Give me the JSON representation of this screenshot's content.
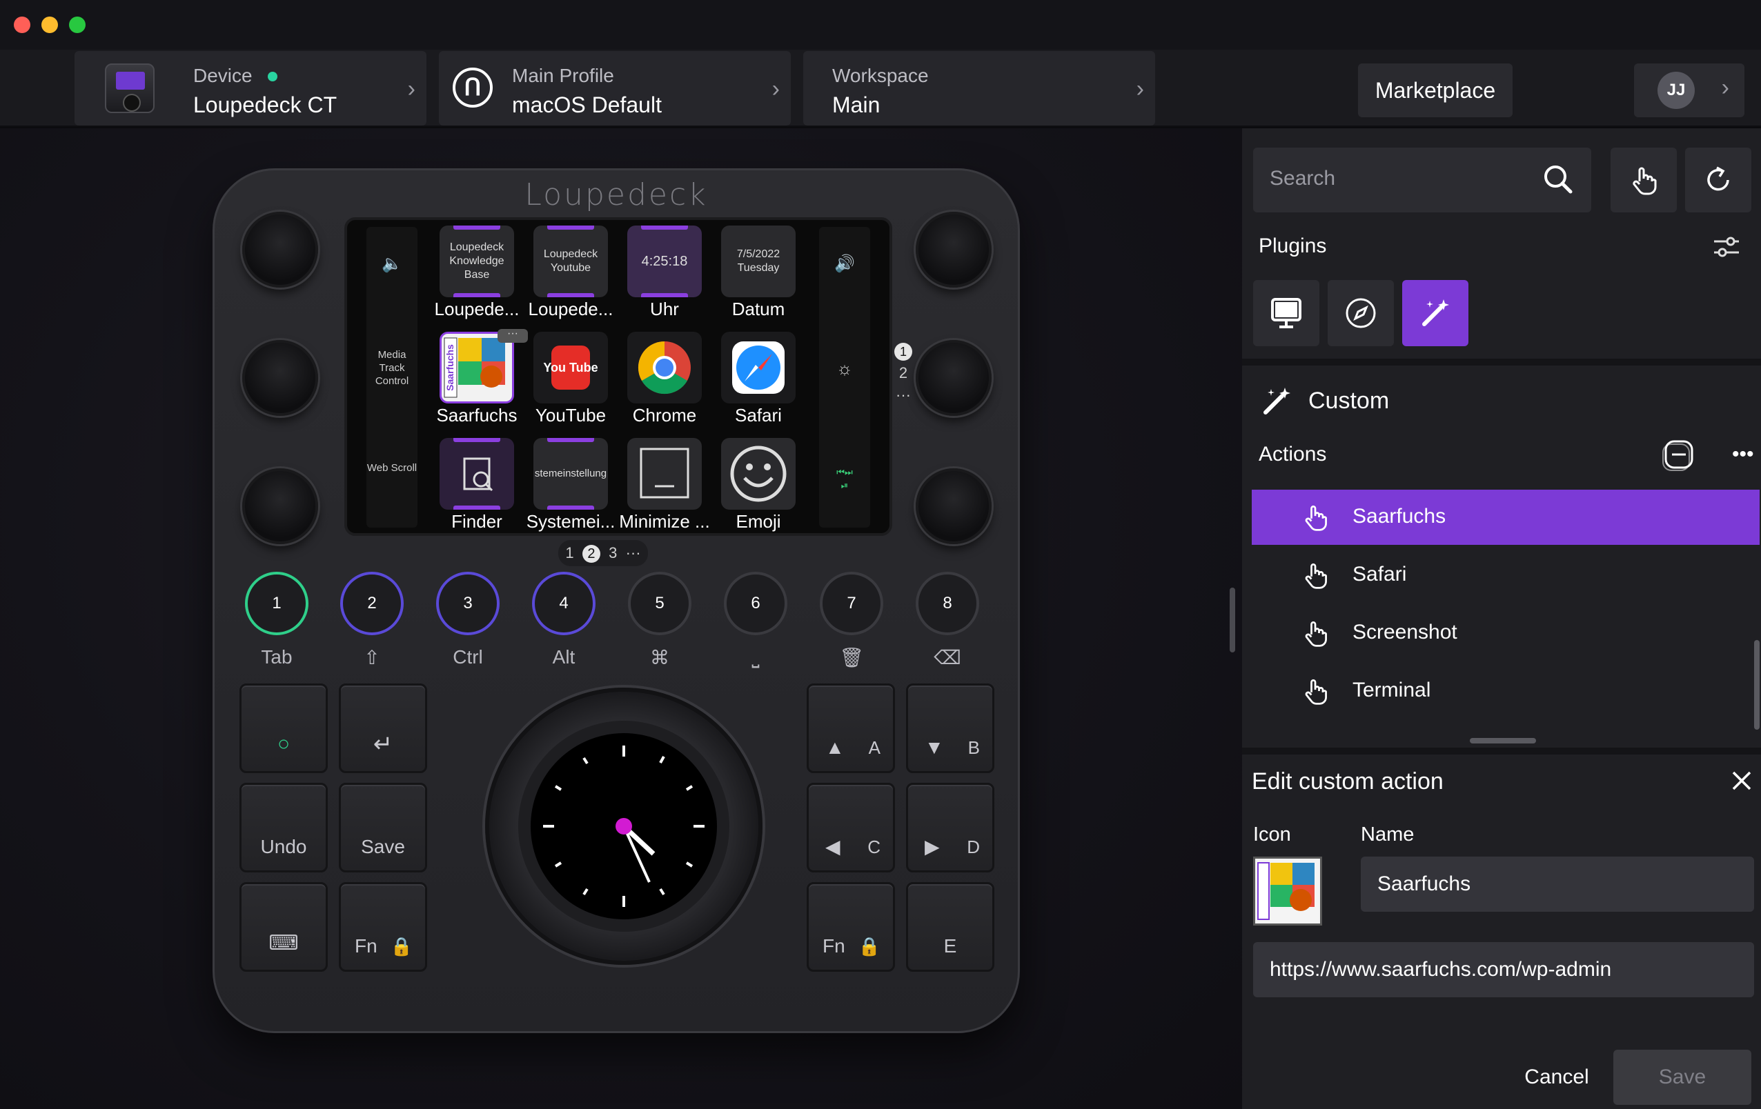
{
  "topbar": {
    "device": {
      "label": "Device",
      "value": "Loupedeck CT",
      "status_color": "#29d3a0"
    },
    "profile": {
      "label": "Main Profile",
      "value": "macOS Default"
    },
    "workspace": {
      "label": "Workspace",
      "value": "Main"
    },
    "marketplace": "Marketplace",
    "user_initials": "JJ"
  },
  "device": {
    "brand": "Loupedeck",
    "left_column": [
      "Media Track Control",
      "Web Scroll"
    ],
    "tiles": [
      {
        "text": "Loupedeck Knowledge Base",
        "label": "Loupede..."
      },
      {
        "text": "Loupedeck Youtube",
        "label": "Loupede..."
      },
      {
        "text": "4:25:18",
        "label": "Uhr"
      },
      {
        "text": "7/5/2022 Tuesday",
        "label": "Datum"
      },
      {
        "text": "Saarfuchs",
        "label": "Saarfuchs"
      },
      {
        "text": "You Tube",
        "label": "YouTube"
      },
      {
        "text": "",
        "label": "Chrome"
      },
      {
        "text": "",
        "label": "Safari"
      },
      {
        "text": "",
        "label": "Finder"
      },
      {
        "text": "stemeinstellung",
        "label": "Systemei..."
      },
      {
        "text": "",
        "label": "Minimize ..."
      },
      {
        "text": "",
        "label": "Emoji"
      }
    ],
    "tile_more": "···",
    "page_indicator": {
      "pages": [
        "1",
        "2",
        "3"
      ],
      "current": "2",
      "more": "···"
    },
    "vertical_page_indicator": {
      "pages": [
        "1",
        "2"
      ],
      "current": "1",
      "more": "···"
    },
    "round_buttons": [
      {
        "num": "1",
        "label": "Tab"
      },
      {
        "num": "2",
        "label": "⇧"
      },
      {
        "num": "3",
        "label": "Ctrl"
      },
      {
        "num": "4",
        "label": "Alt"
      },
      {
        "num": "5",
        "label": "⌘"
      },
      {
        "num": "6",
        "label": "⎵"
      },
      {
        "num": "7",
        "label": "🗑"
      },
      {
        "num": "8",
        "label": "⌫"
      }
    ],
    "keys": {
      "undo": "Undo",
      "save": "Save",
      "fn": "Fn",
      "a": "A",
      "b": "B",
      "c": "C",
      "d": "D",
      "e": "E"
    },
    "accent_green": "#2fcf8a",
    "accent_purple": "#7c3ad6"
  },
  "panel": {
    "search_placeholder": "Search",
    "plugins_label": "Plugins",
    "custom_title": "Custom",
    "actions_label": "Actions",
    "actions": [
      "Saarfuchs",
      "Safari",
      "Screenshot",
      "Terminal"
    ],
    "selected_action": "Saarfuchs",
    "edit": {
      "title": "Edit custom action",
      "icon_label": "Icon",
      "name_label": "Name",
      "name_value": "Saarfuchs",
      "url_value": "https://www.saarfuchs.com/wp-admin",
      "cancel": "Cancel",
      "save": "Save"
    }
  }
}
